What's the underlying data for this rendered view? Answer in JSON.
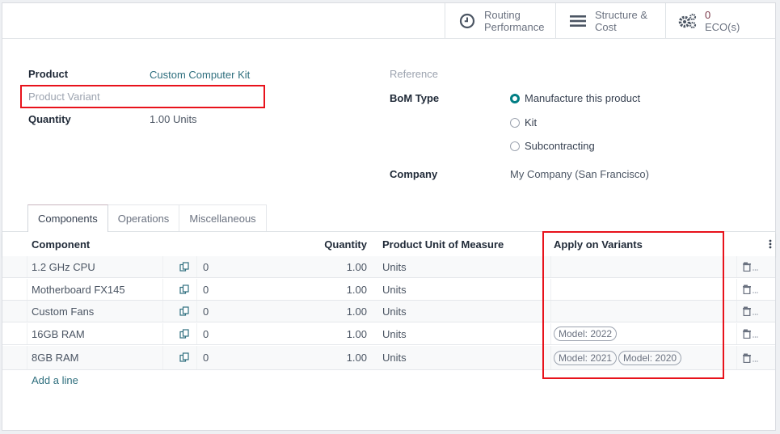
{
  "button_box": {
    "routing": {
      "line1": "Routing",
      "line2": "Performance",
      "icon": "clock-icon"
    },
    "structure": {
      "line1": "Structure &",
      "line2": "Cost",
      "icon": "bars-icon"
    },
    "eco": {
      "count": "0",
      "label": "ECO(s)",
      "icon": "cogs-icon"
    }
  },
  "form": {
    "product": {
      "label": "Product",
      "value": "Custom Computer Kit"
    },
    "product_variant": {
      "placeholder": "Product Variant"
    },
    "quantity": {
      "label": "Quantity",
      "value": "1.00",
      "unit": "Units"
    },
    "reference": {
      "label": "Reference"
    },
    "bom_type": {
      "label": "BoM Type",
      "options": [
        {
          "label": "Manufacture this product",
          "selected": true
        },
        {
          "label": "Kit",
          "selected": false
        },
        {
          "label": "Subcontracting",
          "selected": false
        }
      ]
    },
    "company": {
      "label": "Company",
      "value": "My Company (San Francisco)"
    }
  },
  "tabs": [
    {
      "label": "Components",
      "active": true
    },
    {
      "label": "Operations",
      "active": false
    },
    {
      "label": "Miscellaneous",
      "active": false
    }
  ],
  "table": {
    "headers": {
      "component": "Component",
      "quantity": "Quantity",
      "uom": "Product Unit of Measure",
      "variants": "Apply on Variants"
    },
    "rows": [
      {
        "component": "1.2 GHz CPU",
        "count": "0",
        "quantity": "1.00",
        "uom": "Units",
        "variants": []
      },
      {
        "component": "Motherboard FX145",
        "count": "0",
        "quantity": "1.00",
        "uom": "Units",
        "variants": []
      },
      {
        "component": "Custom Fans",
        "count": "0",
        "quantity": "1.00",
        "uom": "Units",
        "variants": []
      },
      {
        "component": "16GB RAM",
        "count": "0",
        "quantity": "1.00",
        "uom": "Units",
        "variants": [
          "Model: 2022"
        ]
      },
      {
        "component": "8GB RAM",
        "count": "0",
        "quantity": "1.00",
        "uom": "Units",
        "variants": [
          "Model: 2021",
          "Model: 2020"
        ]
      }
    ],
    "add_line": "Add a line"
  },
  "colors": {
    "accent": "#017e84",
    "highlight": "#e8121b",
    "link": "#2f6f7e"
  }
}
